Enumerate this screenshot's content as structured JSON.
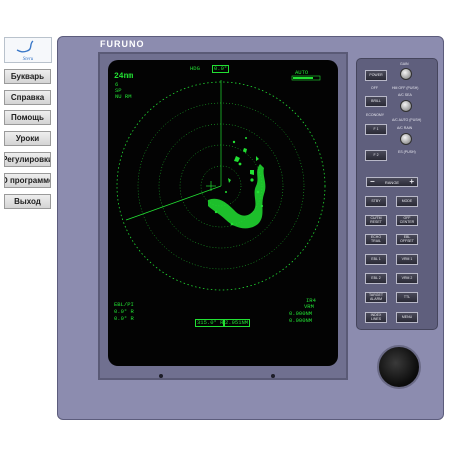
{
  "sidebar": {
    "logo_text": "Steru",
    "items": [
      {
        "label": "Букварь"
      },
      {
        "label": "Справка"
      },
      {
        "label": "Помощь"
      },
      {
        "label": "Уроки"
      },
      {
        "label": "Регулировки"
      },
      {
        "label": "О программе"
      },
      {
        "label": "Выход"
      }
    ]
  },
  "radar": {
    "brand": "FURUNO",
    "screen": {
      "range": "24nm",
      "ring_interval": "6",
      "pulse": "SP",
      "mode": "NU RM",
      "hdg_label": "HDG",
      "hdg_value": "0.0°",
      "auto_label": "AUTO",
      "ebl_line1": "EBL/PI",
      "ebl_line2": "0.0° R",
      "ebl_line3": "0.0° R",
      "ir_label": "IR4",
      "vrm_label": "VRM",
      "vrm_val1": "0.000NM",
      "vrm_val2": "0.000NM",
      "cursor_bearing": "315.0° R",
      "cursor_range": "2.951NM"
    },
    "panel": {
      "gain_label": "GAIN",
      "off_label": "OFF",
      "hm_off_label": "HM OFF (PUSH)",
      "ac_sea_label": "A/C SEA",
      "economy_label": "ECONOMY",
      "ac_auto_label": "A/C AUTO (PUSH)",
      "ac_rain_label": "A/C RAIN",
      "es_label": "ES (PUSH)",
      "range_label": "RANGE",
      "range_minus": "−",
      "range_plus": "+",
      "keys": {
        "power": "POWER",
        "brill": "BRILL",
        "f1": "F 1",
        "f2": "F 2",
        "stby": "STBY",
        "mode": "MODE",
        "cursor": "CU/TM RESET",
        "offcenter": "OFF CENTER",
        "echo": "ECHO TRAIL",
        "ebl_offset": "EBL OFFSET",
        "ebl1": "EBL 1",
        "vrm1": "VRM 1",
        "ebl2": "EBL 2",
        "vrm2": "VRM 2",
        "target": "TARGET ALARM",
        "ttl": "TTL",
        "index": "INDEX LINES",
        "menu": "MENU"
      }
    }
  }
}
